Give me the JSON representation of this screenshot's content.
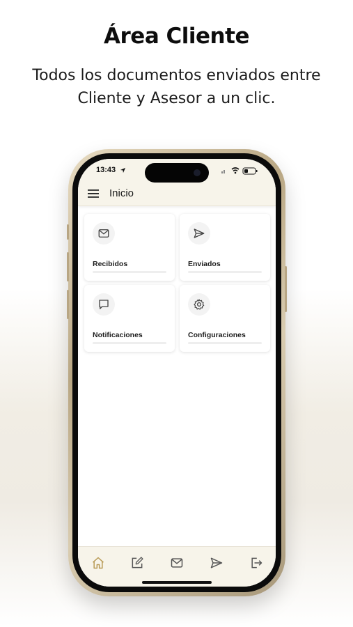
{
  "promo": {
    "title": "Área Cliente",
    "subtitle": "Todos los documentos enviados entre Cliente y Asesor a un clic."
  },
  "status_bar": {
    "time": "13:43",
    "icons": [
      "location-arrow-icon",
      "signal-icon",
      "wifi-icon",
      "battery-icon"
    ]
  },
  "header": {
    "menu_icon": "hamburger-menu-icon",
    "title": "Inicio"
  },
  "cards": [
    {
      "label": "Recibidos",
      "icon": "mail-icon"
    },
    {
      "label": "Enviados",
      "icon": "send-icon"
    },
    {
      "label": "Notificaciones",
      "icon": "chat-bubble-icon"
    },
    {
      "label": "Configuraciones",
      "icon": "gear-icon"
    }
  ],
  "bottom_nav": [
    {
      "icon": "home-icon",
      "active": true
    },
    {
      "icon": "edit-icon",
      "active": false
    },
    {
      "icon": "mail-icon",
      "active": false
    },
    {
      "icon": "send-icon",
      "active": false
    },
    {
      "icon": "logout-icon",
      "active": false
    }
  ],
  "colors": {
    "accent": "#b89a55",
    "app_bar": "#f7f4ea",
    "icon_gray": "#555555",
    "phone_frame": "#c9b894"
  }
}
